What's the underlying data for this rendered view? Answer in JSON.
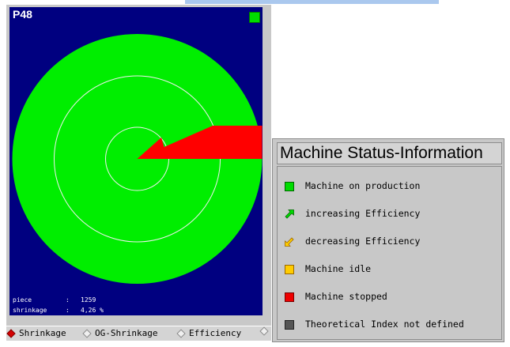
{
  "machine": {
    "id": "P48",
    "status_color": "#00dd00",
    "gauge": {
      "background_color": "#00ee00",
      "sector_color": "#ff0000",
      "ring_color": "#f0f0f0"
    },
    "readouts": [
      {
        "label": "piece",
        "value": "1259"
      },
      {
        "label": "shrinkage",
        "value": "4,26 %"
      }
    ]
  },
  "tabs": [
    {
      "label": "Shrinkage",
      "active": true
    },
    {
      "label": "OG-Shrinkage",
      "active": false
    },
    {
      "label": "Efficiency",
      "active": false
    }
  ],
  "legend": {
    "title": "Machine Status-Information",
    "items": [
      {
        "label": "Machine on production",
        "icon": "square-green-icon",
        "color": "#00dd00"
      },
      {
        "label": "increasing Efficiency",
        "icon": "arrow-up-green-icon",
        "color": "#00dd00"
      },
      {
        "label": "decreasing Efficiency",
        "icon": "arrow-down-yellow-icon",
        "color": "#ffcc00"
      },
      {
        "label": "Machine idle",
        "icon": "square-yellow-icon",
        "color": "#ffcc00"
      },
      {
        "label": "Machine stopped",
        "icon": "square-red-icon",
        "color": "#ee0000"
      },
      {
        "label": "Theoretical Index not defined",
        "icon": "square-gray-icon",
        "color": "#555555"
      }
    ]
  }
}
